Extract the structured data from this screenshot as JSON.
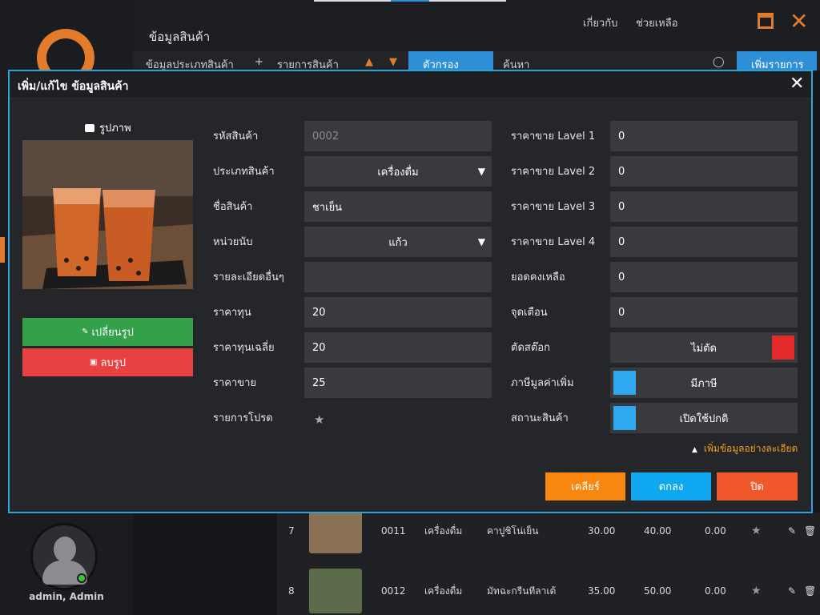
{
  "app": {
    "page_title": "ข้อมูลสินค้า",
    "nav_about": "เกี่ยวกับ",
    "nav_help": "ช่วยเหลือ",
    "toolbar_category": "ข้อมูลประเภทสินค้า",
    "toolbar_plus": "+",
    "toolbar_items": "รายการสินค้า",
    "toolbar_filter": "ตัวกรอง",
    "toolbar_search_placeholder": "ค้นหา",
    "toolbar_add": "เพิ่มรายการ",
    "user_name": "admin, Admin",
    "accent_orange": "#e37b2c",
    "accent_blue": "#2d8fd6"
  },
  "modal": {
    "title": "เพิ่ม/แก้ไข ข้อมูลสินค้า",
    "image_label": "รูปภาพ",
    "change_image": "เปลี่ยนรูป",
    "delete_image": "ลบรูป",
    "fields": {
      "code_label": "รหัสสินค้า",
      "code_value": "0002",
      "type_label": "ประเภทสินค้า",
      "type_value": "เครื่องดื่ม",
      "name_label": "ชื่อสินค้า",
      "name_value": "ชาเย็น",
      "unit_label": "หน่วยนับ",
      "unit_value": "แก้ว",
      "detail_label": "รายละเอียดอื่นๆ",
      "detail_value": "",
      "cost_label": "ราคาทุน",
      "cost_value": "20",
      "avgcost_label": "ราคาทุนเฉลี่ย",
      "avgcost_value": "20",
      "price_label": "ราคาขาย",
      "price_value": "25",
      "fav_label": "รายการโปรด",
      "lv1_label": "ราคาขาย Lavel 1",
      "lv1_value": "0",
      "lv2_label": "ราคาขาย Lavel 2",
      "lv2_value": "0",
      "lv3_label": "ราคาขาย Lavel 3",
      "lv3_value": "0",
      "lv4_label": "ราคาขาย Lavel 4",
      "lv4_value": "0",
      "stock_label": "ยอดคงเหลือ",
      "stock_value": "0",
      "alert_label": "จุดเตือน",
      "alert_value": "0",
      "cutstock_label": "ตัดสต๊อก",
      "cutstock_value": "ไม่ตัด",
      "vat_label": "ภาษีมูลค่าเพิ่ม",
      "vat_value": "มีภาษี",
      "status_label": "สถานะสินค้า",
      "status_value": "เปิดใช้ปกติ"
    },
    "more_details": "เพิ่มข้อมูลอย่างละเอียด",
    "btn_clear": "เคลียร์",
    "btn_ok": "ตกลง",
    "btn_close": "ปิด",
    "btn_clear_color": "#f7870f",
    "btn_ok_color": "#10a8f0",
    "btn_close_color": "#f0582c"
  },
  "table": {
    "rows": [
      {
        "no": "7",
        "code": "0011",
        "type": "เครื่องดื่ม",
        "name": "คาปูชิโน่เย็น",
        "cost": "30.00",
        "price": "40.00",
        "discount": "0.00"
      },
      {
        "no": "8",
        "code": "0012",
        "type": "เครื่องดื่ม",
        "name": "มัทฉะกรีนทีลาเต้",
        "cost": "35.00",
        "price": "50.00",
        "discount": "0.00"
      }
    ]
  }
}
